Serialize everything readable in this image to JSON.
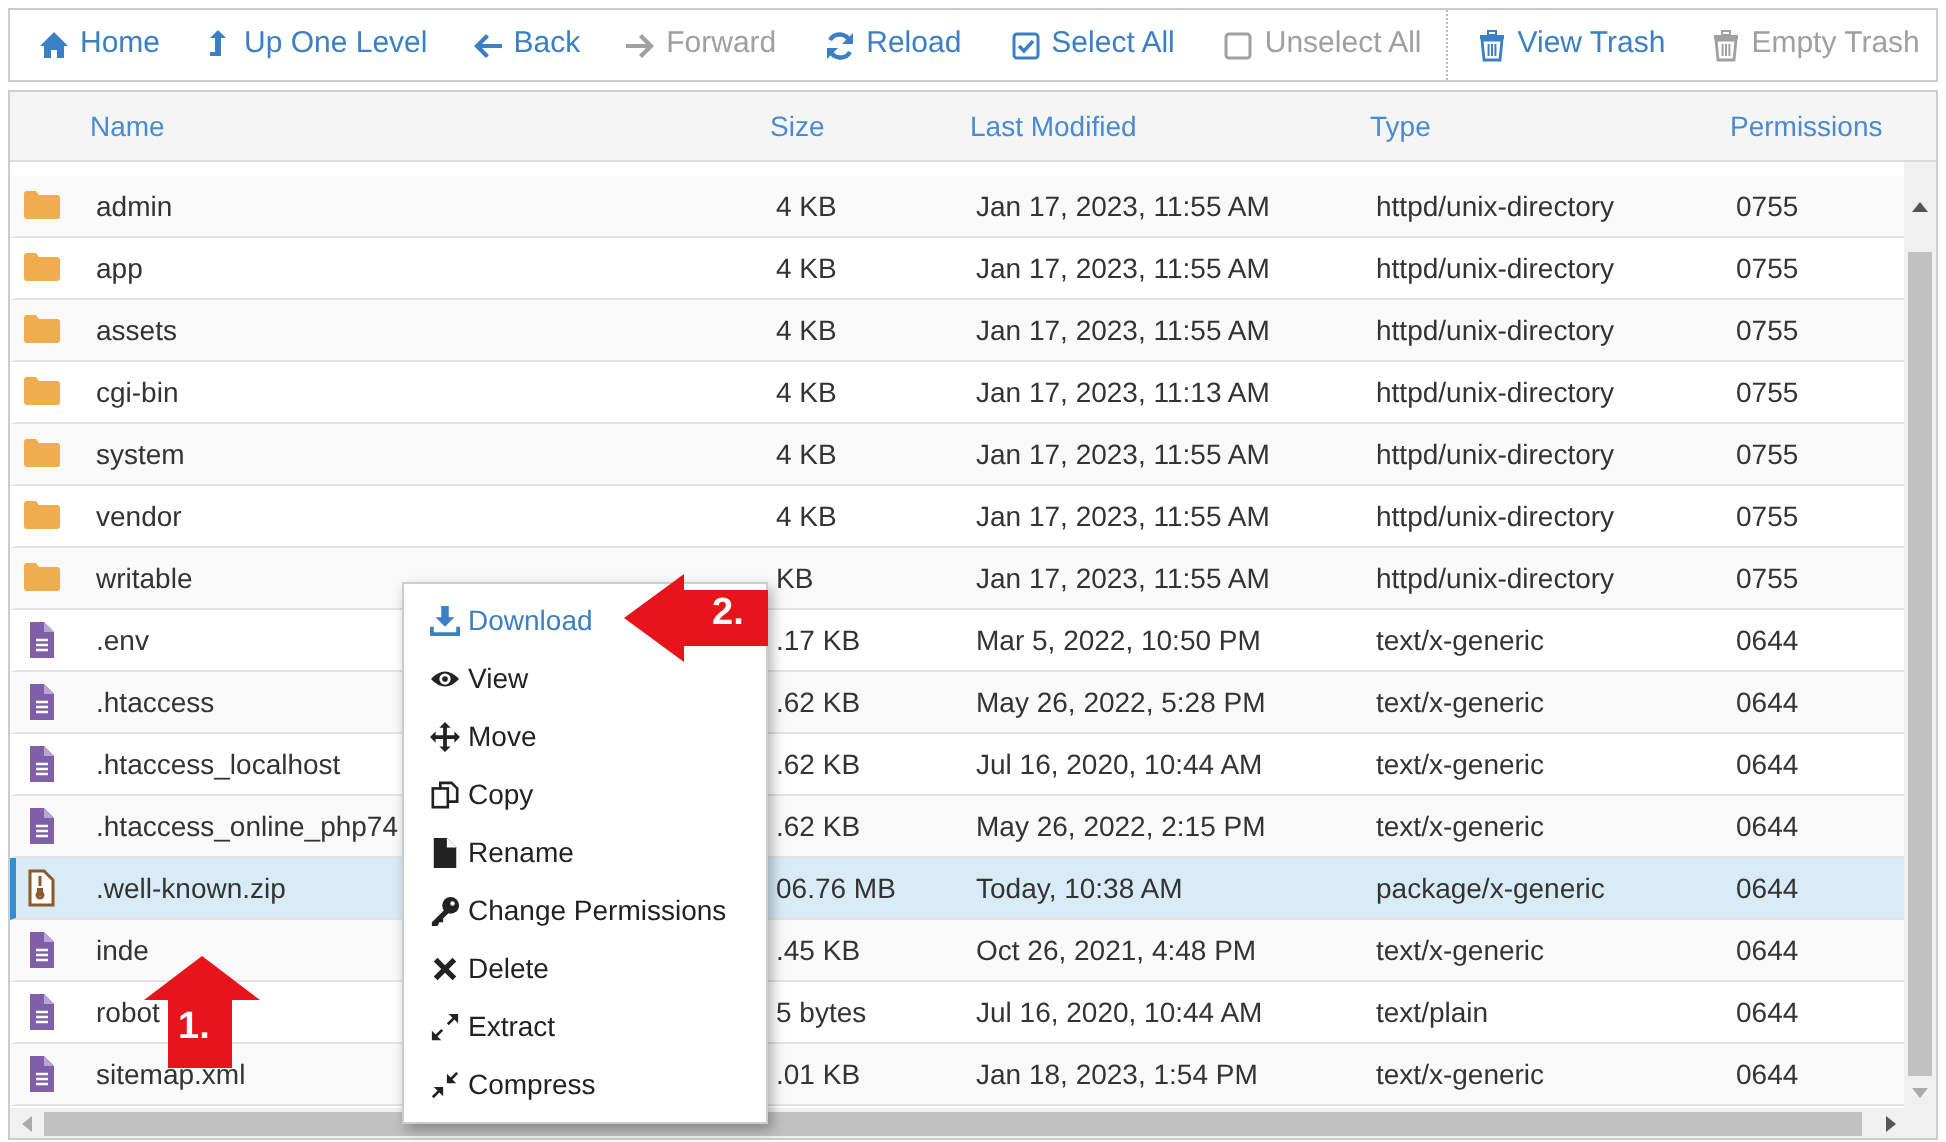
{
  "toolbar": [
    {
      "label": "Home",
      "disabled": false
    },
    {
      "label": "Up One Level",
      "disabled": false
    },
    {
      "label": "Back",
      "disabled": false
    },
    {
      "label": "Forward",
      "disabled": true
    },
    {
      "label": "Reload",
      "disabled": false
    },
    {
      "label": "Select All",
      "disabled": false
    },
    {
      "label": "Unselect All",
      "disabled": true
    },
    {
      "label": "View Trash",
      "disabled": false
    },
    {
      "label": "Empty Trash",
      "disabled": true
    }
  ],
  "table": {
    "columns": [
      "Name",
      "Size",
      "Last Modified",
      "Type",
      "Permissions"
    ],
    "rows": [
      {
        "kind": "folder",
        "selected": false,
        "cells": [
          "admin",
          "4 KB",
          "Jan 17, 2023, 11:55 AM",
          "httpd/unix-directory",
          "0755"
        ]
      },
      {
        "kind": "folder",
        "selected": false,
        "cells": [
          "app",
          "4 KB",
          "Jan 17, 2023, 11:55 AM",
          "httpd/unix-directory",
          "0755"
        ]
      },
      {
        "kind": "folder",
        "selected": false,
        "cells": [
          "assets",
          "4 KB",
          "Jan 17, 2023, 11:55 AM",
          "httpd/unix-directory",
          "0755"
        ]
      },
      {
        "kind": "folder",
        "selected": false,
        "cells": [
          "cgi-bin",
          "4 KB",
          "Jan 17, 2023, 11:13 AM",
          "httpd/unix-directory",
          "0755"
        ]
      },
      {
        "kind": "folder",
        "selected": false,
        "cells": [
          "system",
          "4 KB",
          "Jan 17, 2023, 11:55 AM",
          "httpd/unix-directory",
          "0755"
        ]
      },
      {
        "kind": "folder",
        "selected": false,
        "cells": [
          "vendor",
          "4 KB",
          "Jan 17, 2023, 11:55 AM",
          "httpd/unix-directory",
          "0755"
        ]
      },
      {
        "kind": "folder",
        "selected": false,
        "cells": [
          "writable",
          "KB",
          "Jan 17, 2023, 11:55 AM",
          "httpd/unix-directory",
          "0755"
        ]
      },
      {
        "kind": "file",
        "selected": false,
        "cells": [
          ".env",
          ".17 KB",
          "Mar 5, 2022, 10:50 PM",
          "text/x-generic",
          "0644"
        ]
      },
      {
        "kind": "file",
        "selected": false,
        "cells": [
          ".htaccess",
          ".62 KB",
          "May 26, 2022, 5:28 PM",
          "text/x-generic",
          "0644"
        ]
      },
      {
        "kind": "file",
        "selected": false,
        "cells": [
          ".htaccess_localhost",
          ".62 KB",
          "Jul 16, 2020, 10:44 AM",
          "text/x-generic",
          "0644"
        ]
      },
      {
        "kind": "file",
        "selected": false,
        "cells": [
          ".htaccess_online_php74",
          ".62 KB",
          "May 26, 2022, 2:15 PM",
          "text/x-generic",
          "0644"
        ]
      },
      {
        "kind": "archive",
        "selected": true,
        "cells": [
          ".well-known.zip",
          "06.76 MB",
          "Today, 10:38 AM",
          "package/x-generic",
          "0644"
        ]
      },
      {
        "kind": "file",
        "selected": false,
        "cells": [
          "inde",
          ".45 KB",
          "Oct 26, 2021, 4:48 PM",
          "text/x-generic",
          "0644"
        ]
      },
      {
        "kind": "file",
        "selected": false,
        "cells": [
          "robot",
          "5 bytes",
          "Jul 16, 2020, 10:44 AM",
          "text/plain",
          "0644"
        ]
      },
      {
        "kind": "file",
        "selected": false,
        "cells": [
          "sitemap.xml",
          ".01 KB",
          "Jan 18, 2023, 1:54 PM",
          "text/x-generic",
          "0644"
        ]
      }
    ]
  },
  "context_menu": [
    {
      "label": "Download",
      "selected": true
    },
    {
      "label": "View",
      "selected": false
    },
    {
      "label": "Move",
      "selected": false
    },
    {
      "label": "Copy",
      "selected": false
    },
    {
      "label": "Rename",
      "selected": false
    },
    {
      "label": "Change Permissions",
      "selected": false
    },
    {
      "label": "Delete",
      "selected": false
    },
    {
      "label": "Extract",
      "selected": false
    },
    {
      "label": "Compress",
      "selected": false
    }
  ],
  "annotations": [
    {
      "label": "1."
    },
    {
      "label": "2."
    }
  ]
}
